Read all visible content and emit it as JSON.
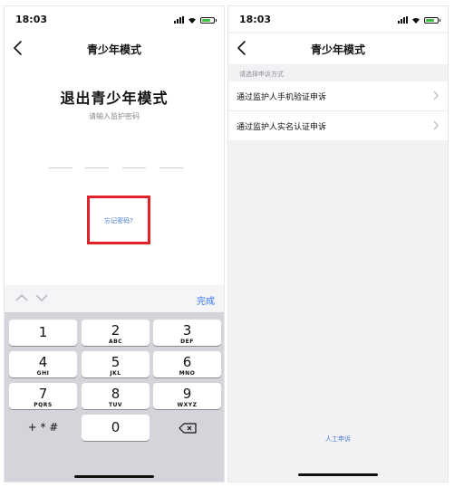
{
  "left": {
    "status": {
      "time": "18:03"
    },
    "nav": {
      "title": "青少年模式"
    },
    "heading": "退出青少年模式",
    "password_hint": "请输入监护密码",
    "forgot_link": "忘记密码?",
    "keyboard": {
      "done": "完成",
      "keys": [
        {
          "num": "1",
          "sub": ""
        },
        {
          "num": "2",
          "sub": "ABC"
        },
        {
          "num": "3",
          "sub": "DEF"
        },
        {
          "num": "4",
          "sub": "GHI"
        },
        {
          "num": "5",
          "sub": "JKL"
        },
        {
          "num": "6",
          "sub": "MNO"
        },
        {
          "num": "7",
          "sub": "PQRS"
        },
        {
          "num": "8",
          "sub": "TUV"
        },
        {
          "num": "9",
          "sub": "WXYZ"
        },
        {
          "num": "0",
          "sub": ""
        }
      ],
      "symbols": "+ * #"
    }
  },
  "right": {
    "status": {
      "time": "18:03"
    },
    "nav": {
      "title": "青少年模式"
    },
    "section_label": "请选择申诉方式",
    "options": [
      {
        "label": "通过监护人手机验证申诉"
      },
      {
        "label": "通过监护人实名认证申诉"
      }
    ],
    "manual_appeal": "人工申诉"
  },
  "colors": {
    "accent": "#4a7bd0",
    "highlight_box": "#e1222b",
    "battery": "#3cbc3c",
    "keyboard_bg": "#d3d5da"
  }
}
